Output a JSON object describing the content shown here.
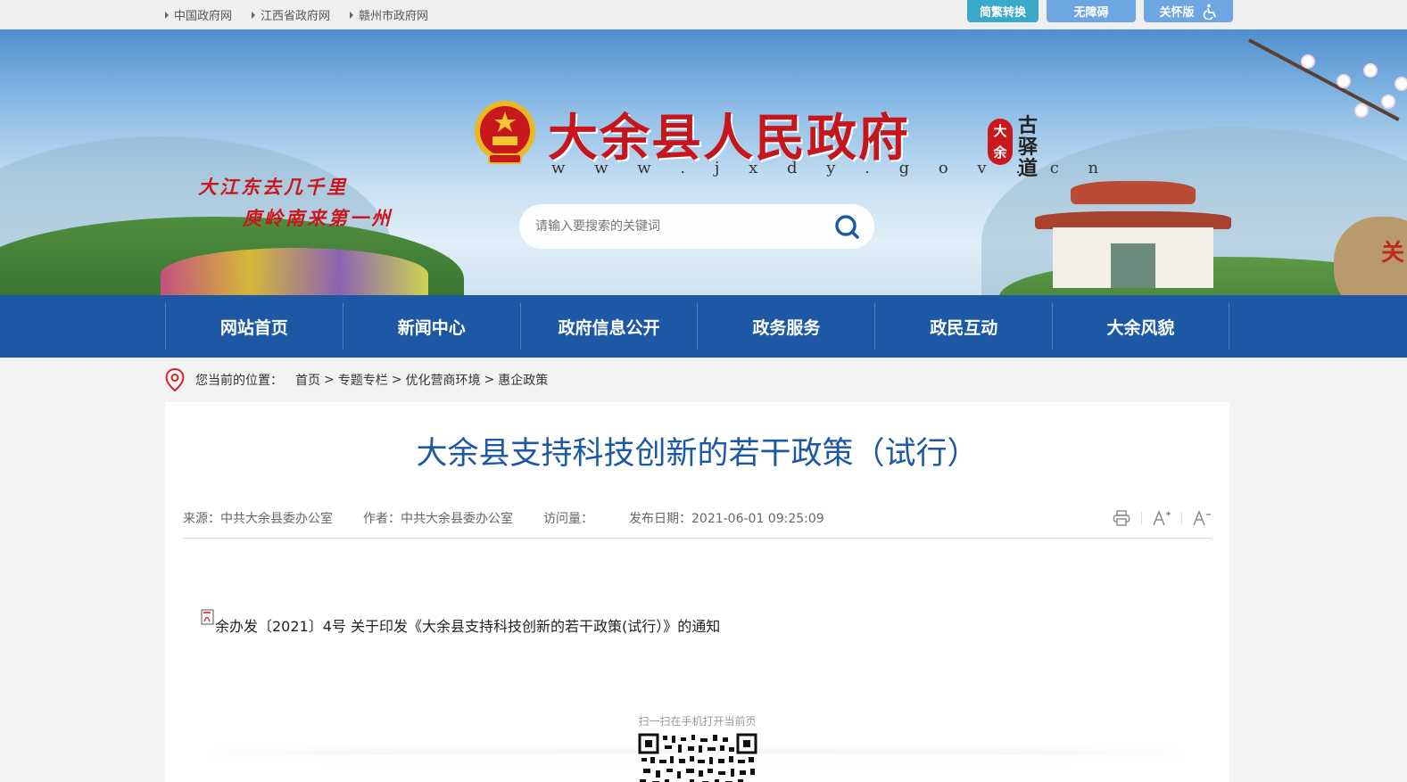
{
  "top_links": [
    "中国政府网",
    "江西省政府网",
    "赣州市政府网"
  ],
  "top_buttons": {
    "simplified_traditional": "简繁转换",
    "accessible": "无障碍",
    "elderly": "关怀版"
  },
  "banner": {
    "site_title": "大余县人民政府",
    "site_url": "w w w . j x d y . g o v . c n",
    "slogan_line1": "大江东去几千里",
    "slogan_line2": "庾岭南来第一州",
    "seal_red": "大余",
    "seal_black": "古驿道",
    "rock_text": "关"
  },
  "search": {
    "placeholder": "请输入要搜索的关键词"
  },
  "nav": [
    "网站首页",
    "新闻中心",
    "政府信息公开",
    "政务服务",
    "政民互动",
    "大余风貌"
  ],
  "breadcrumb": {
    "label": "您当前的位置：",
    "items": [
      "首页",
      "专题专栏",
      "优化营商环境",
      "惠企政策"
    ],
    "separator": ">"
  },
  "article": {
    "title": "大余县支持科技创新的若干政策（试行）",
    "source": "来源：中共大余县委办公室",
    "author": "作者：中共大余县委办公室",
    "visits": "访问量：",
    "publish_date": "发布日期：2021-06-01 09:25:09",
    "attachment": "余办发〔2021〕4号 关于印发《大余县支持科技创新的若干政策(试行）》的通知",
    "qr_caption": "扫一扫在手机打开当前页"
  },
  "colors": {
    "primary": "#1d58a5",
    "title_red": "#c5161d",
    "topbar_bg": "#efefef"
  }
}
